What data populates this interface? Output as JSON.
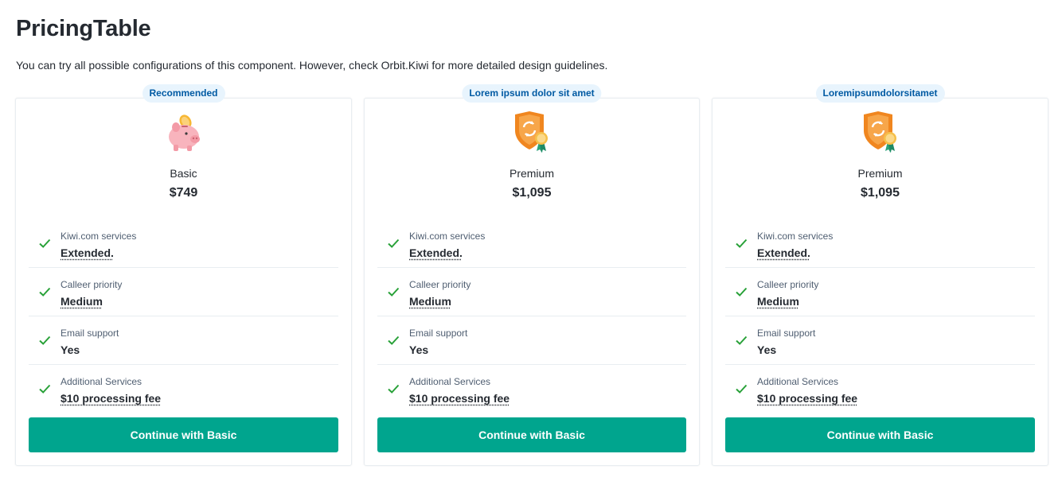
{
  "page": {
    "title": "PricingTable",
    "description": "You can try all possible configurations of this component. However, check Orbit.Kiwi for more detailed design guidelines."
  },
  "plans": [
    {
      "badge": "Recommended",
      "illustration": "piggy-bank-illustration",
      "name": "Basic",
      "price": "$749",
      "features": [
        {
          "label": "Kiwi.com services",
          "value": "Extended."
        },
        {
          "label": "Calleer priority",
          "value": "Medium"
        },
        {
          "label": "Email support",
          "value": "Yes"
        },
        {
          "label": "Additional Services",
          "value": "$10 processing fee"
        }
      ],
      "cta": "Continue with Basic"
    },
    {
      "badge": "Lorem ipsum dolor sit amet",
      "illustration": "insurance-badge-illustration",
      "name": "Premium",
      "price": "$1,095",
      "features": [
        {
          "label": "Kiwi.com services",
          "value": "Extended."
        },
        {
          "label": "Calleer priority",
          "value": "Medium"
        },
        {
          "label": "Email support",
          "value": "Yes"
        },
        {
          "label": "Additional Services",
          "value": "$10 processing fee"
        }
      ],
      "cta": "Continue with Basic"
    },
    {
      "badge": "Loremipsumdolorsitamet",
      "illustration": "insurance-badge-illustration",
      "name": "Premium",
      "price": "$1,095",
      "features": [
        {
          "label": "Kiwi.com services",
          "value": "Extended."
        },
        {
          "label": "Calleer priority",
          "value": "Medium"
        },
        {
          "label": "Email support",
          "value": "Yes"
        },
        {
          "label": "Additional Services",
          "value": "$10 processing fee"
        }
      ],
      "cta": "Continue with Basic"
    }
  ],
  "colors": {
    "primary_button": "#00a58e",
    "check": "#28a138",
    "badge_bg": "#e8f4fd",
    "badge_text": "#005aa3"
  }
}
